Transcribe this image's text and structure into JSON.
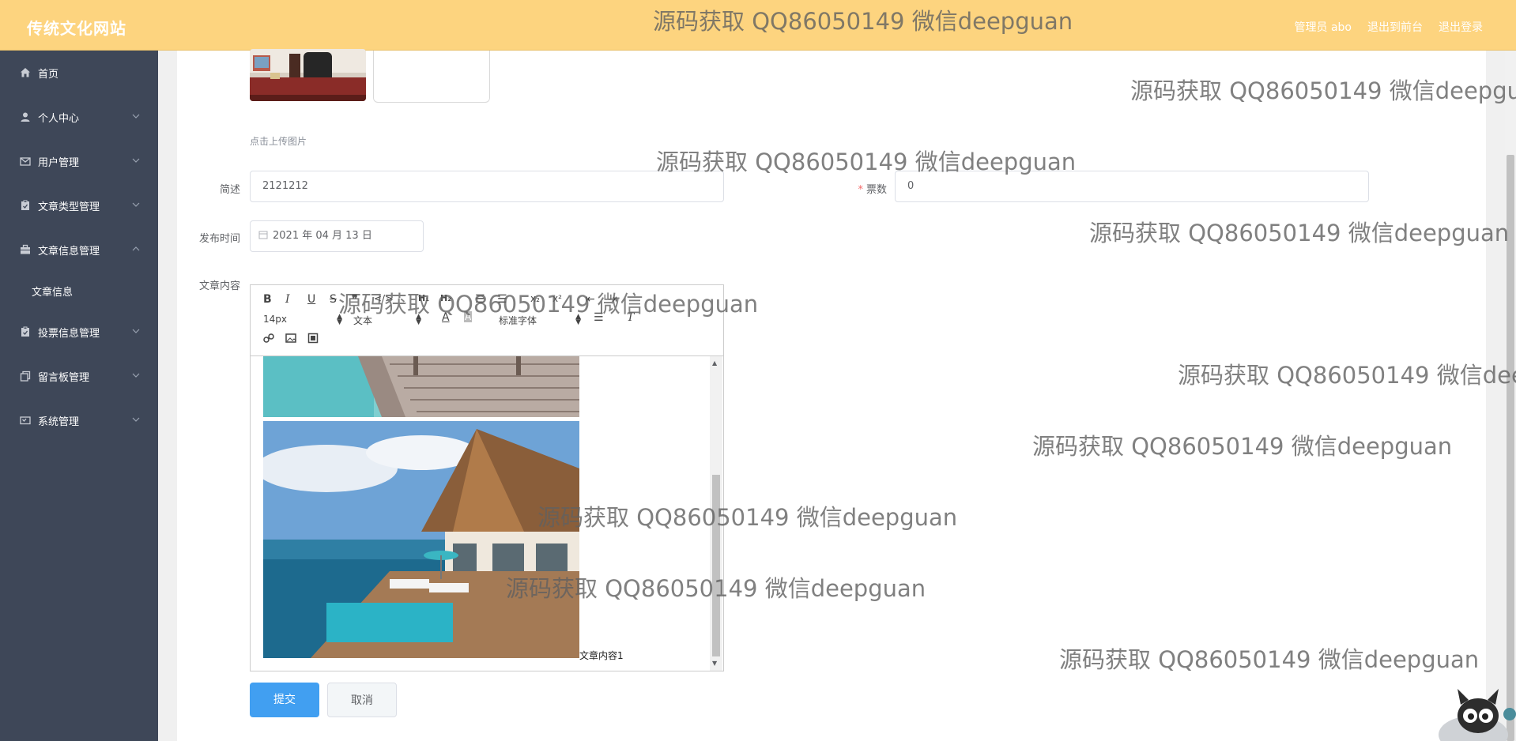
{
  "header": {
    "brand": "传统文化网站",
    "links": [
      "管理员 abo",
      "退出到前台",
      "退出登录"
    ]
  },
  "sidebar": {
    "items": [
      {
        "label": "首页",
        "icon": "home-icon",
        "expandable": false
      },
      {
        "label": "个人中心",
        "icon": "user-icon",
        "expandable": true
      },
      {
        "label": "用户管理",
        "icon": "mail-icon",
        "expandable": true
      },
      {
        "label": "文章类型管理",
        "icon": "clipboard-icon",
        "expandable": true
      },
      {
        "label": "文章信息管理",
        "icon": "briefcase-icon",
        "expandable": true,
        "expanded": true
      },
      {
        "label": "投票信息管理",
        "icon": "clipboard-check-icon",
        "expandable": true
      },
      {
        "label": "留言板管理",
        "icon": "copy-icon",
        "expandable": true
      },
      {
        "label": "系统管理",
        "icon": "credit-card-icon",
        "expandable": true
      }
    ],
    "submenu": {
      "label": "文章信息"
    }
  },
  "form": {
    "upload_tip": "点击上传图片",
    "description_label": "简述",
    "description_value": "2121212",
    "votes_label": "票数",
    "votes_required": "*",
    "votes_value": "0",
    "publish_label": "发布时间",
    "publish_value": "2021 年 04 月 13 日",
    "content_label": "文章内容",
    "content_text": "文章内容1",
    "submit_label": "提交",
    "cancel_label": "取消"
  },
  "editor": {
    "font_size": "14px",
    "block_type": "文本",
    "font_family": "标准字体"
  },
  "watermark": "源码获取 QQ86050149 微信deepguan",
  "colors": {
    "header_bg": "#fdd47f",
    "sidebar_bg": "#3e4758",
    "primary": "#419ff1"
  }
}
